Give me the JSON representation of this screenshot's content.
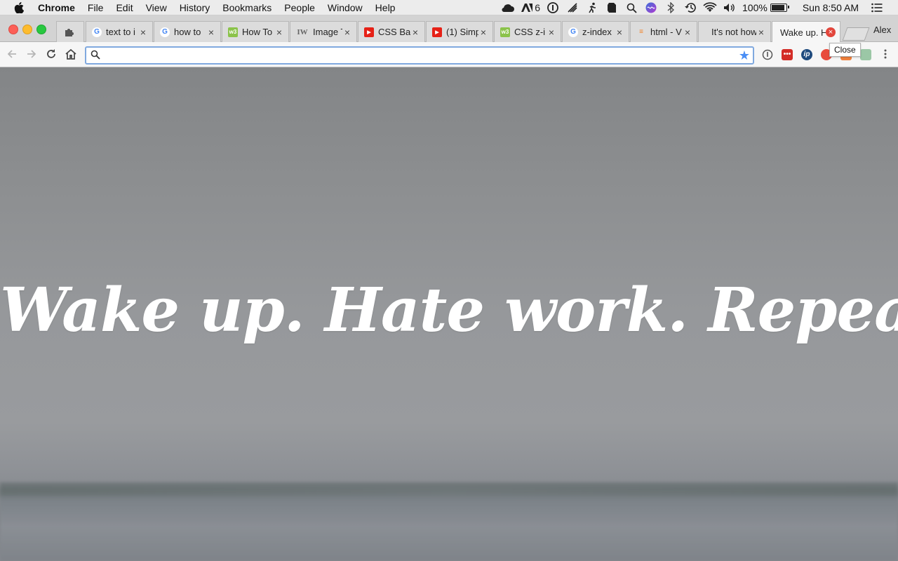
{
  "menubar": {
    "app": "Chrome",
    "items": [
      "File",
      "Edit",
      "View",
      "History",
      "Bookmarks",
      "People",
      "Window",
      "Help"
    ],
    "adobe_count": "6",
    "battery": "100%",
    "clock": "Sun 8:50 AM"
  },
  "tabs": [
    {
      "title": "",
      "favicon": "extensions-icon"
    },
    {
      "title": "text to i",
      "favicon": "google-icon"
    },
    {
      "title": "how to",
      "favicon": "google-icon"
    },
    {
      "title": "How To",
      "favicon": "w3schools-icon"
    },
    {
      "title": "Image T",
      "favicon": "iw-icon"
    },
    {
      "title": "CSS Ba",
      "favicon": "youtube-icon"
    },
    {
      "title": "(1) Simp",
      "favicon": "youtube-icon"
    },
    {
      "title": "CSS z-i",
      "favicon": "w3schools-icon"
    },
    {
      "title": "z-index",
      "favicon": "google-icon"
    },
    {
      "title": "html - V",
      "favicon": "stackoverflow-icon"
    },
    {
      "title": "It's not how",
      "favicon": "none"
    },
    {
      "title": "Wake up. H",
      "favicon": "none",
      "active": true
    }
  ],
  "profile": "Alex",
  "tooltip": "Close",
  "omnibox": {
    "value": "",
    "placeholder": ""
  },
  "page": {
    "headline": "Wake up. Hate work. Repeat."
  }
}
